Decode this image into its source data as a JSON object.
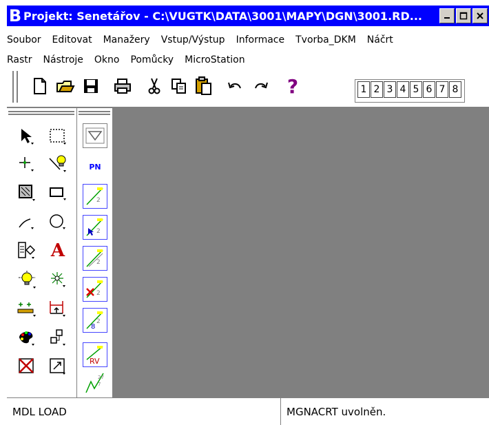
{
  "window": {
    "title": "Projekt: Senetářov - C:\\VUGTK\\DATA\\3001\\MAPY\\DGN\\3001.RD...",
    "logo": "B",
    "controls": [
      "minimize",
      "maximize",
      "close"
    ]
  },
  "menu": {
    "row1": [
      "Soubor",
      "Editovat",
      "Manažery",
      "Vstup/Výstup",
      "Informace",
      "Tvorba_DKM",
      "Náčrt"
    ],
    "row2": [
      "Rastr",
      "Nástroje",
      "Okno",
      "Pomůcky",
      "MicroStation"
    ]
  },
  "toolbar": {
    "icons": [
      "new-file-icon",
      "open-folder-icon",
      "save-icon",
      "print-icon",
      "cut-icon",
      "copy-icon",
      "paste-icon",
      "undo-icon",
      "redo-icon",
      "help-icon"
    ],
    "help_glyph": "?",
    "views": [
      "1",
      "2",
      "3",
      "4",
      "5",
      "6",
      "7",
      "8"
    ]
  },
  "midpanel": {
    "pn_label": "PN",
    "rv_label": "RV"
  },
  "status": {
    "left": "MDL LOAD",
    "right": "MGNACRT uvolněn."
  },
  "colors": {
    "titlebar": "#0000ff",
    "canvas": "#808080",
    "help": "#800080",
    "accent_blue": "#0000ff"
  }
}
